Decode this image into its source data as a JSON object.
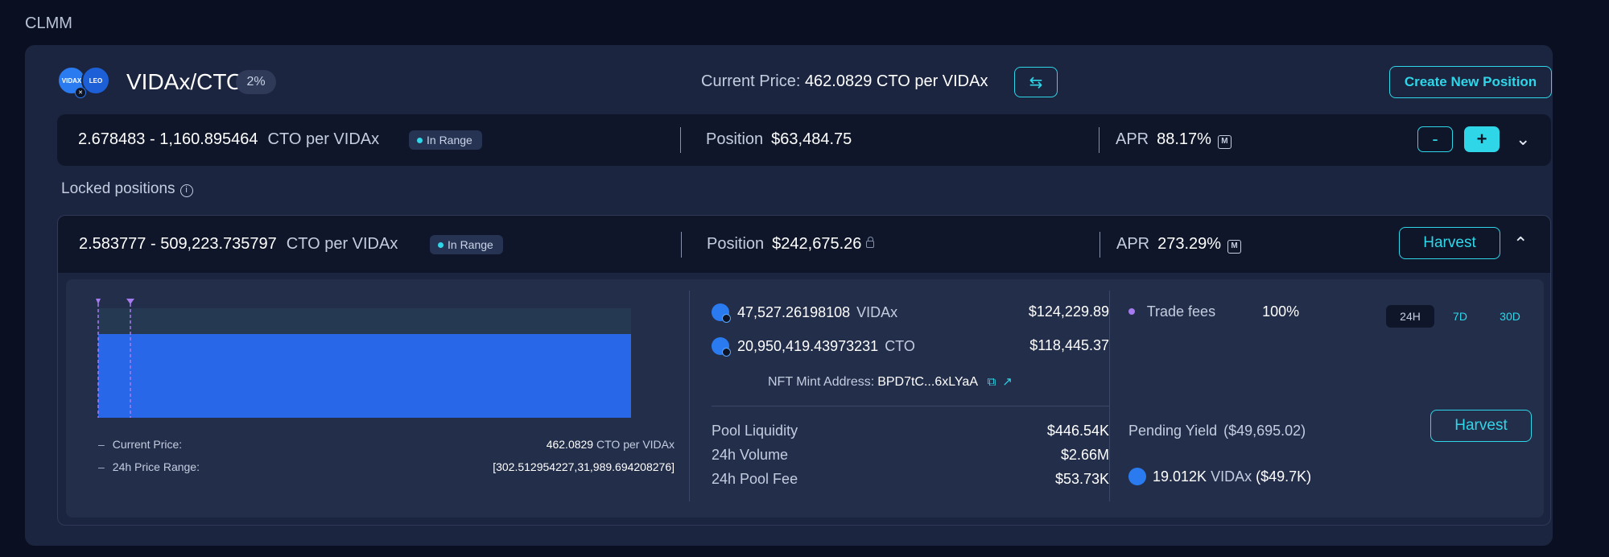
{
  "section_label": "CLMM",
  "pool": {
    "pair": "VIDAx/CTO",
    "fee": "2%",
    "current_price_label": "Current Price:",
    "current_price_value": "462.0829 CTO per VIDAx",
    "create_position_label": "Create New Position",
    "token_a_logo_text": "VIDAX",
    "token_b_logo_text": "LEO"
  },
  "positions": [
    {
      "range": "2.678483 - 1,160.895464",
      "unit": "CTO per VIDAx",
      "status": "In Range",
      "position_label": "Position",
      "position_value": "$63,484.75",
      "apr_label": "APR",
      "apr_value": "88.17%",
      "minus_label": "-",
      "plus_label": "+"
    }
  ],
  "locked": {
    "section_label": "Locked positions",
    "position": {
      "range": "2.583777 - 509,223.735797",
      "unit": "CTO per VIDAx",
      "status": "In Range",
      "position_label": "Position",
      "position_value": "$242,675.26",
      "apr_label": "APR",
      "apr_value": "273.29%",
      "harvest_label": "Harvest"
    },
    "details": {
      "chart": {
        "current_price_label": "Current Price:",
        "current_price_value": "462.0829",
        "current_price_unit": "CTO per VIDAx",
        "range_label": "24h Price Range:",
        "range_value": "[302.512954227,31,989.694208276]"
      },
      "tokens": [
        {
          "amount": "47,527.26198108",
          "symbol": "VIDAx",
          "usd": "$124,229.89"
        },
        {
          "amount": "20,950,419.43973231",
          "symbol": "CTO",
          "usd": "$118,445.37"
        }
      ],
      "nft_label": "NFT Mint Address:",
      "nft_address": "BPD7tC...6xLYaA",
      "stats": [
        {
          "label": "Pool Liquidity",
          "value": "$446.54K"
        },
        {
          "label": "24h Volume",
          "value": "$2.66M"
        },
        {
          "label": "24h Pool Fee",
          "value": "$53.73K"
        }
      ],
      "fees_label": "Trade fees",
      "fees_pct": "100%",
      "tabs": [
        "24H",
        "7D",
        "30D"
      ],
      "active_tab": "24H",
      "pending_label": "Pending Yield",
      "pending_value": "($49,695.02)",
      "harvest_label": "Harvest",
      "yield_amount": "19.012K",
      "yield_symbol": "VIDAx",
      "yield_usd": "($49.7K)"
    }
  },
  "colors": {
    "accent": "#2fd6e8",
    "bar_blue": "#2767e8",
    "bar_dark": "#253a52",
    "marker": "#a77bf0",
    "background": "#0a1021",
    "card": "#1b2540"
  },
  "icons": [
    "swap-icon",
    "chevron-down-icon",
    "chevron-up-icon",
    "info-icon",
    "lock-icon",
    "mining-icon",
    "copy-icon",
    "external-link-icon"
  ]
}
